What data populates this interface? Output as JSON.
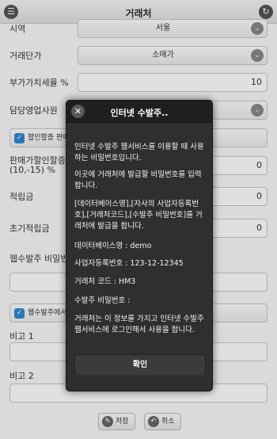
{
  "header": {
    "title": "거래처",
    "menu_icon": "list-icon",
    "back_icon": "refresh-icon"
  },
  "form": {
    "region": {
      "label": "시역",
      "value": "서울"
    },
    "price_level": {
      "label": "거래단가",
      "value": "소매가"
    },
    "vat_rate": {
      "label": "부가가치세율 %",
      "value": "10"
    },
    "sales_rep": {
      "label": "담당영업사원"
    },
    "discount_check": {
      "label": "할인할증 판매"
    },
    "discount_rate": {
      "label_line1": "판매가할인할증",
      "label_line2": "(10,-15) %",
      "value": "0"
    },
    "points": {
      "label": "적립금",
      "value": "0"
    },
    "initial_points": {
      "label": "초기적립금",
      "value": "0"
    },
    "web_order_pw": {
      "label": "웹수발주 비밀번호"
    },
    "web_order_check": {
      "label": "웹수발주에서"
    },
    "note1": {
      "label": "비고 1"
    },
    "note2": {
      "label": "비고 2"
    }
  },
  "footer": {
    "save_label": "저장",
    "cancel_label": "취소"
  },
  "popup": {
    "title": "인터넷 수발주..",
    "p1": "인터넷 수발주 웹서비스를 이용할 때 사용하는 비밀번호입니다.",
    "p2": "이곳에 거래처에 발급할 비밀번호를 입력합니다.",
    "p3": "[데이터베이스명],[자사의 사업자등록번호],[거래처코드],[수발주 비밀번호]를 거래처에 발급을 합니다.",
    "db": "데이터베이스명 : demo",
    "biz": "사업자등록번호 : 123-12-12345",
    "code": "거래처 코드 : HM3",
    "pw": "수발주 비밀번호 :",
    "p4": "거래처는 이 정보를 가지고 인터넷 수발주 웹서비스에 로그인해서 사용을 합니다.",
    "confirm_label": "확인"
  },
  "colors": {
    "accent": "#3388cc",
    "popup_bg": "#2f2f2f"
  }
}
